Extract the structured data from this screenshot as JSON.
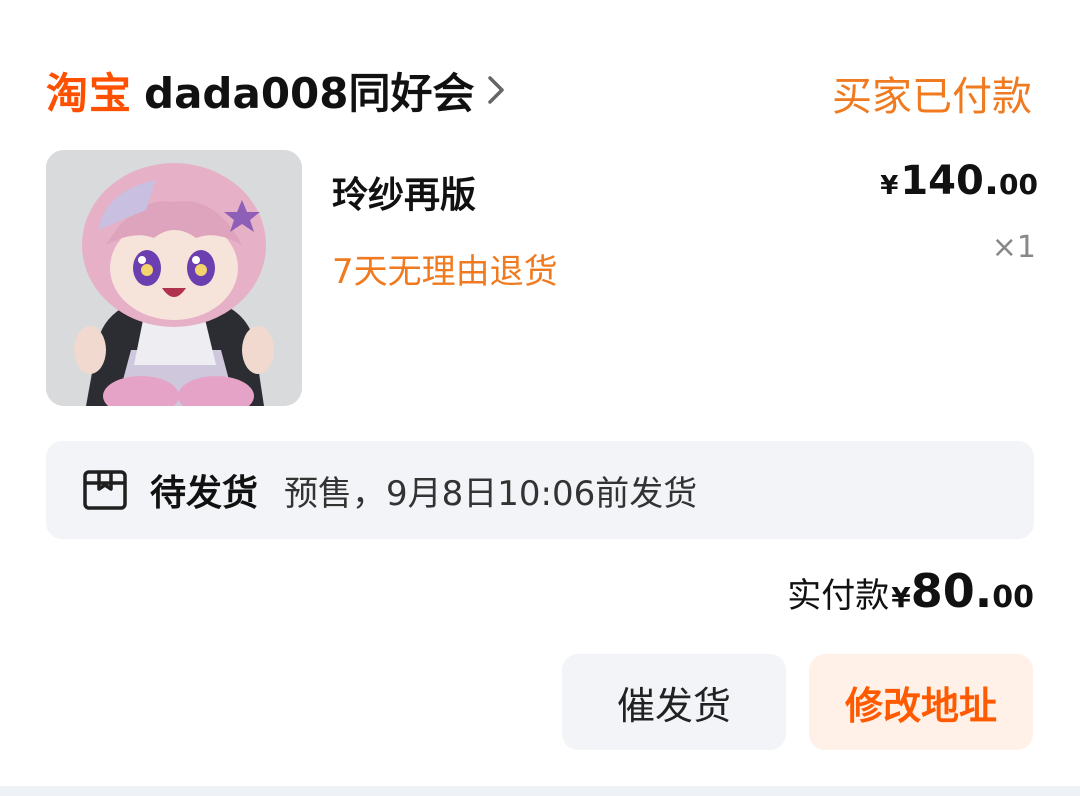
{
  "shop": {
    "platform_logo": "淘宝",
    "name": "dada008同好会"
  },
  "order_status": "买家已付款",
  "item": {
    "title": "玲纱再版",
    "tag": "7天无理由退货",
    "price_currency": "¥",
    "price_int": "140.",
    "price_dec": "00",
    "quantity": "×1"
  },
  "shipping": {
    "icon": "box-icon",
    "label": "待发货",
    "text": "预售，9月8日10:06前发货"
  },
  "payment": {
    "label": "实付款",
    "currency": "¥",
    "amount_int": "80.",
    "amount_dec": "00"
  },
  "actions": {
    "urge_label": "催发货",
    "address_label": "修改地址"
  },
  "colors": {
    "accent": "#ff5000",
    "status": "#f07a1f",
    "panel": "#f2f4f7"
  }
}
